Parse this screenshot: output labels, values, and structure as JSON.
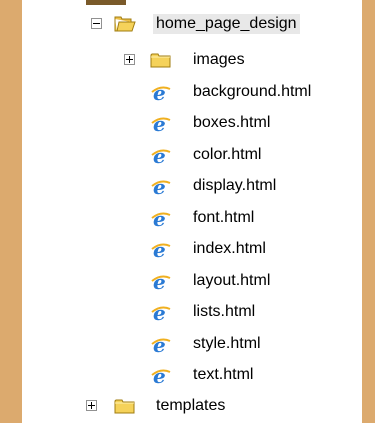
{
  "tree": {
    "root": {
      "label": "home_page_design",
      "expanded": true,
      "selected": true,
      "icon": "folder-open-icon"
    },
    "children": [
      {
        "label": "images",
        "type": "folder",
        "expanded": false,
        "icon": "folder-icon"
      },
      {
        "label": "background.html",
        "type": "file",
        "icon": "ie-html-file-icon"
      },
      {
        "label": "boxes.html",
        "type": "file",
        "icon": "ie-html-file-icon"
      },
      {
        "label": "color.html",
        "type": "file",
        "icon": "ie-html-file-icon"
      },
      {
        "label": "display.html",
        "type": "file",
        "icon": "ie-html-file-icon"
      },
      {
        "label": "font.html",
        "type": "file",
        "icon": "ie-html-file-icon"
      },
      {
        "label": "index.html",
        "type": "file",
        "icon": "ie-html-file-icon"
      },
      {
        "label": "layout.html",
        "type": "file",
        "icon": "ie-html-file-icon"
      },
      {
        "label": "lists.html",
        "type": "file",
        "icon": "ie-html-file-icon"
      },
      {
        "label": "style.html",
        "type": "file",
        "icon": "ie-html-file-icon"
      },
      {
        "label": "text.html",
        "type": "file",
        "icon": "ie-html-file-icon"
      }
    ],
    "sibling": {
      "label": "templates",
      "expanded": false,
      "icon": "folder-icon"
    }
  },
  "colors": {
    "background": "#dcaa6e",
    "panel": "#ffffff",
    "folder": "#f0c93c",
    "selection": "#e8e8e8"
  }
}
